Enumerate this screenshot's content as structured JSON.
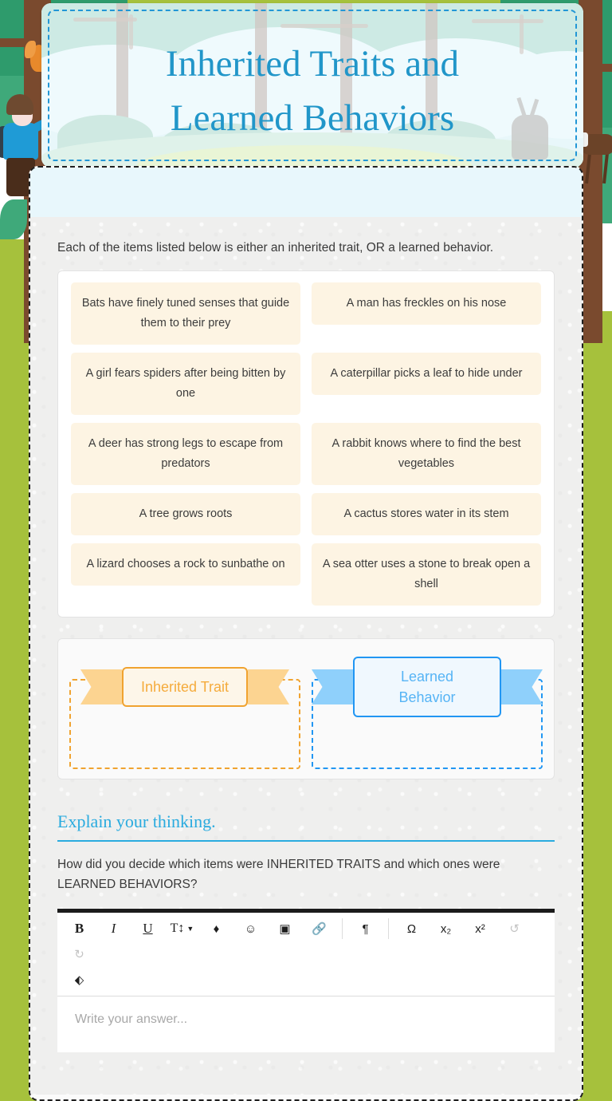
{
  "colors": {
    "title_blue": "#2196c9",
    "accent_blue": "#2196f3",
    "accent_orange": "#f0a330",
    "page_green": "#a6c13c",
    "chip_cream": "#fdf4e3"
  },
  "banner": {
    "title_line1": "Inherited Traits and",
    "title_line2": "Learned Behaviors"
  },
  "main": {
    "intro": "Each of the items listed below is either an inherited trait, OR a learned behavior.",
    "items": [
      "Bats have finely tuned senses that guide them to their prey",
      "A man has freckles on his nose",
      "A girl fears spiders after being bitten by one",
      "A caterpillar picks a leaf to hide under",
      "A deer has strong legs to escape from predators",
      "A rabbit knows where to find the best vegetables",
      "A tree grows roots",
      "A cactus stores water in its stem",
      "A lizard chooses a rock to sunbathe on",
      "A sea otter uses a stone to break open a shell"
    ],
    "zones": [
      {
        "label": "Inherited Trait",
        "color": "#f0a330"
      },
      {
        "label": "Learned Behavior",
        "color": "#2196f3"
      }
    ]
  },
  "explain": {
    "heading": "Explain your thinking.",
    "question": "How did you decide which items were INHERITED TRAITS and which ones were LEARNED BEHAVIORS?",
    "placeholder": "Write your answer...",
    "toolbar": [
      {
        "name": "bold",
        "glyph": "B"
      },
      {
        "name": "italic",
        "glyph": "I"
      },
      {
        "name": "underline",
        "glyph": "U"
      },
      {
        "name": "text-size",
        "glyph": "T↕"
      },
      {
        "name": "text-color",
        "glyph": "♦"
      },
      {
        "name": "emoji",
        "glyph": "☺"
      },
      {
        "name": "insert-image",
        "glyph": "▣"
      },
      {
        "name": "insert-link",
        "glyph": "🔗"
      },
      {
        "name": "paragraph-direction",
        "glyph": "¶"
      },
      {
        "name": "special-character",
        "glyph": "Ω"
      },
      {
        "name": "subscript",
        "glyph": "x₂"
      },
      {
        "name": "superscript",
        "glyph": "x²"
      },
      {
        "name": "undo",
        "glyph": "↺"
      },
      {
        "name": "redo",
        "glyph": "↻"
      },
      {
        "name": "clear-formatting",
        "glyph": "⬖"
      }
    ]
  }
}
